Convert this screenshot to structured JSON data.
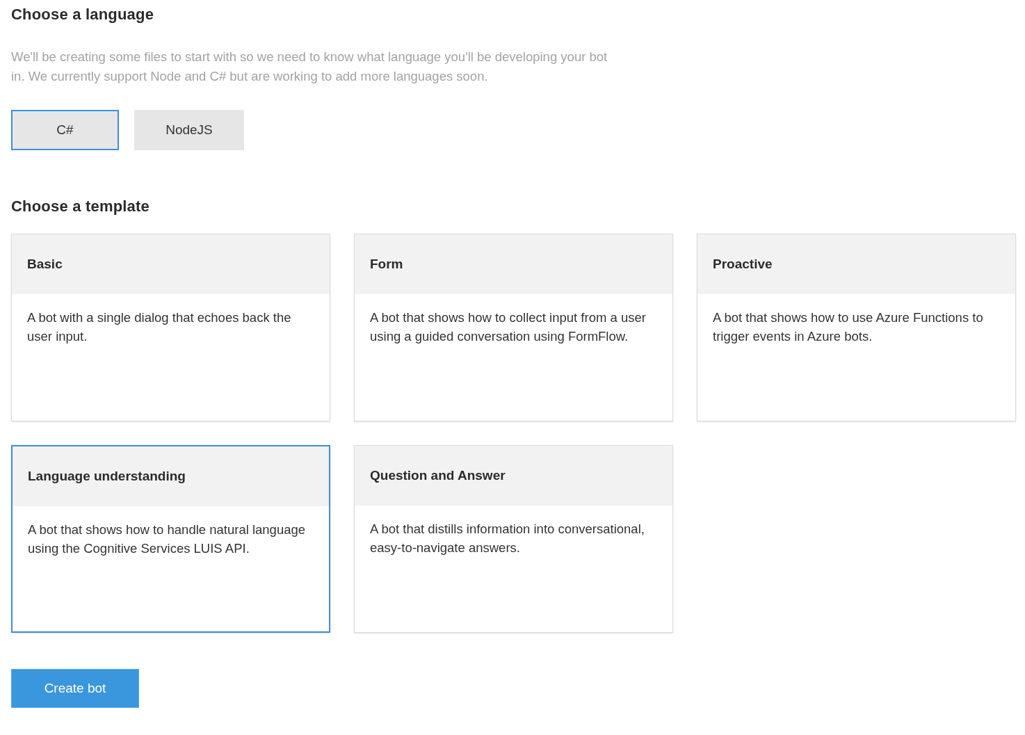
{
  "language_section": {
    "title": "Choose a language",
    "description": "We'll be creating some files to start with so we need to know what language you'll be developing your bot in. We currently support Node and C# but are working to add more languages soon.",
    "languages": [
      {
        "label": "C#",
        "selected": true
      },
      {
        "label": "NodeJS",
        "selected": false
      }
    ]
  },
  "template_section": {
    "title": "Choose a template",
    "templates": [
      {
        "title": "Basic",
        "description": "A bot with a single dialog that echoes back the user input.",
        "selected": false
      },
      {
        "title": "Form",
        "description": "A bot that shows how to collect input from a user using a guided conversation using FormFlow.",
        "selected": false
      },
      {
        "title": "Proactive",
        "description": "A bot that shows how to use Azure Functions to trigger events in Azure bots.",
        "selected": false
      },
      {
        "title": "Language understanding",
        "description": "A bot that shows how to handle natural language using the Cognitive Services LUIS API.",
        "selected": true
      },
      {
        "title": "Question and Answer",
        "description": "A bot that distills information into conversational, easy-to-navigate answers.",
        "selected": false
      }
    ]
  },
  "create_button": {
    "label": "Create bot"
  }
}
